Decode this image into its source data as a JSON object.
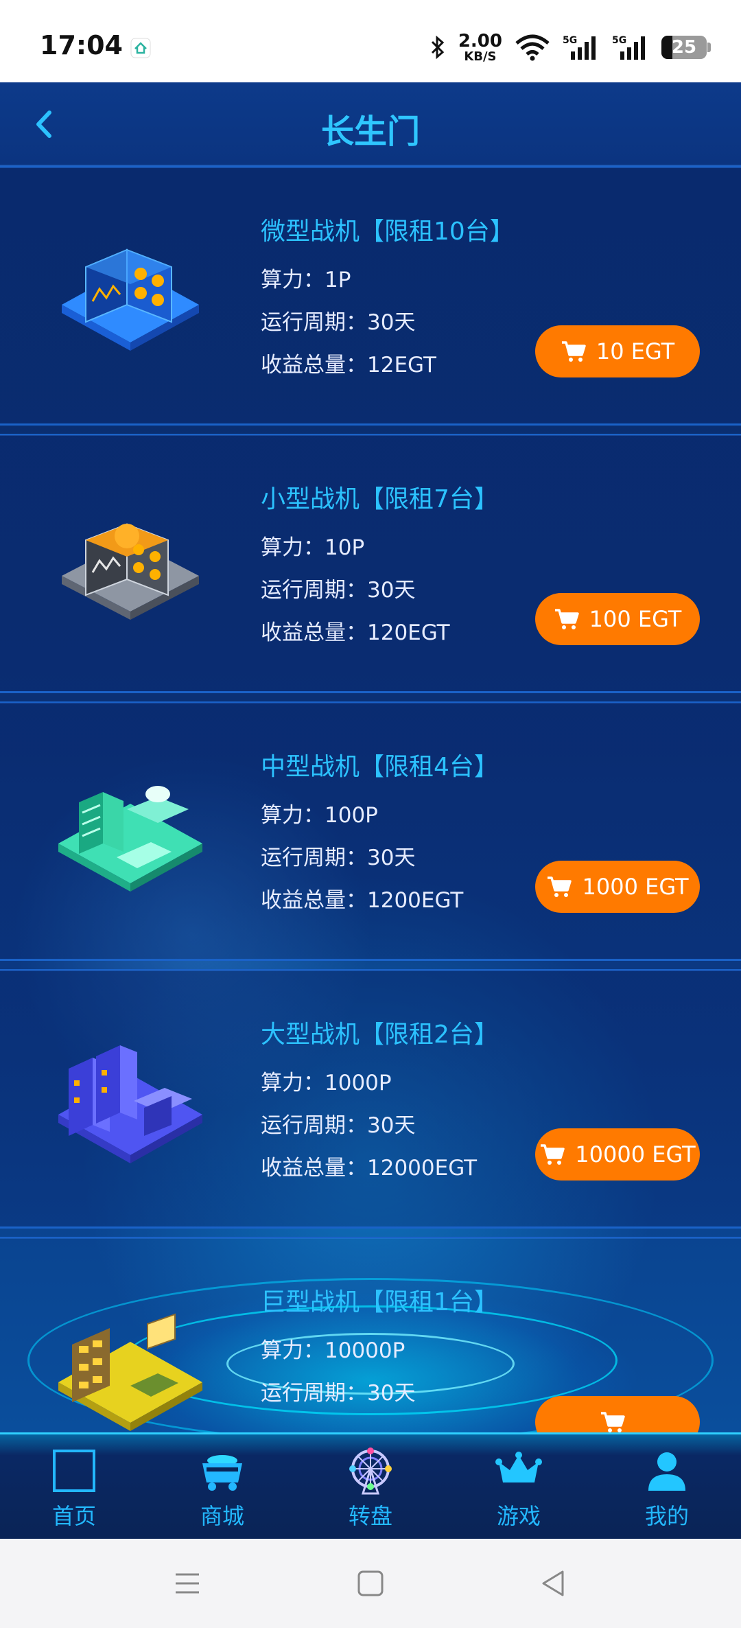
{
  "status": {
    "time": "17:04",
    "speed_value": "2.00",
    "speed_unit": "KB/S",
    "battery": "25"
  },
  "header": {
    "title": "长生门"
  },
  "products": [
    {
      "title": "微型战机【限租10台】",
      "power": "算力：1P",
      "cycle": "运行周期：30天",
      "total": "收益总量：12EGT",
      "price": "10 EGT"
    },
    {
      "title": "小型战机【限租7台】",
      "power": "算力：10P",
      "cycle": "运行周期：30天",
      "total": "收益总量：120EGT",
      "price": "100 EGT"
    },
    {
      "title": "中型战机【限租4台】",
      "power": "算力：100P",
      "cycle": "运行周期：30天",
      "total": "收益总量：1200EGT",
      "price": "1000 EGT"
    },
    {
      "title": "大型战机【限租2台】",
      "power": "算力：1000P",
      "cycle": "运行周期：30天",
      "total": "收益总量：12000EGT",
      "price": "10000 EGT"
    },
    {
      "title": "巨型战机【限租1台】",
      "power": "算力：10000P",
      "cycle": "运行周期：30天",
      "total": "",
      "price": ""
    }
  ],
  "tabs": [
    {
      "label": "首页",
      "icon": "home-square-icon"
    },
    {
      "label": "商城",
      "icon": "mine-cart-icon"
    },
    {
      "label": "转盘",
      "icon": "ferris-wheel-icon"
    },
    {
      "label": "游戏",
      "icon": "crown-icon"
    },
    {
      "label": "我的",
      "icon": "user-icon"
    }
  ],
  "colors": {
    "accent": "#2cc2ff",
    "button": "#ff7a00",
    "background": "#0b2f73"
  }
}
